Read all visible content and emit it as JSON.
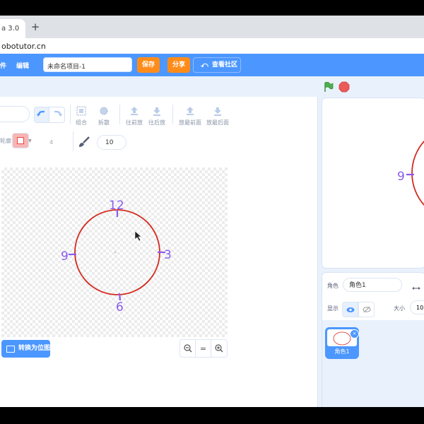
{
  "browser": {
    "tab_title": "a 3.0",
    "new_tab_symbol": "+",
    "url": "obotutor.cn"
  },
  "menubar": {
    "file_label": "件",
    "edit_label": "编辑",
    "project_title_value": "未命名项目-1",
    "save_label": "保存",
    "share_label": "分享",
    "community_label": "查看社区"
  },
  "paint_toolbar": {
    "group_label": "组合",
    "ungroup_label": "拆散",
    "forward_label": "往前放",
    "backward_label": "往后放",
    "front_label": "放最前面",
    "back_label": "放最后面",
    "outline_label": "轮廓",
    "outline_width": "4",
    "brush_size": "10"
  },
  "canvas": {
    "label_12": "12",
    "label_3": "3",
    "label_6": "6",
    "label_9": "9"
  },
  "canvas_footer": {
    "convert_label": "转换为位图",
    "zoom_out": "−",
    "zoom_reset": "=",
    "zoom_in": "+"
  },
  "stage": {
    "label_9": "9"
  },
  "sprite_info": {
    "sprite_label": "角色",
    "sprite_name": "角色1",
    "show_label": "显示",
    "size_label": "大小",
    "size_value": "10"
  },
  "sprite_list": {
    "items": [
      {
        "label": "角色1"
      }
    ]
  },
  "colors": {
    "brand_blue": "#4c97ff",
    "orange": "#ff8c1a",
    "circle_red": "#d32a1f",
    "label_purple": "#8a5cf0",
    "green_flag": "#4caf50",
    "stop_red": "#ec5959"
  }
}
